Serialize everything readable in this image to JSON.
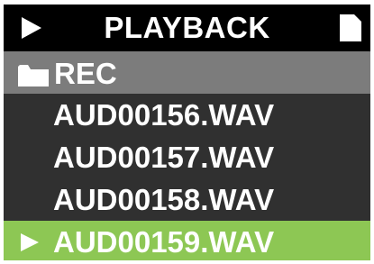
{
  "header": {
    "title": "PLAYBACK",
    "left_icon": "play-icon",
    "right_icon": "file-icon"
  },
  "folder": {
    "icon": "folder-icon",
    "label": "REC"
  },
  "files": [
    {
      "name": "AUD00156.WAV",
      "selected": false
    },
    {
      "name": "AUD00157.WAV",
      "selected": false
    },
    {
      "name": "AUD00158.WAV",
      "selected": false
    },
    {
      "name": "AUD00159.WAV",
      "selected": true,
      "icon": "play-icon"
    }
  ],
  "colors": {
    "header_bg": "#000000",
    "folder_bg": "#7c7c7c",
    "list_bg": "#303030",
    "selected_bg": "#8dc754",
    "text": "#ffffff"
  }
}
